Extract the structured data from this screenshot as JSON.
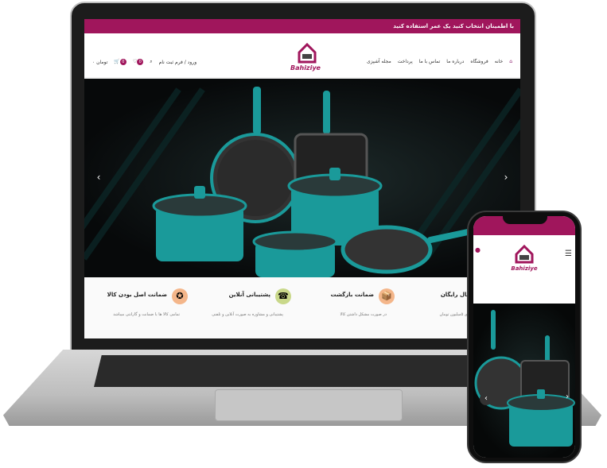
{
  "topbar": {
    "message": "با اطمینان انتخاب کنید یک عمر استفاده کنید"
  },
  "brand": {
    "logo_text": "Bahiziye"
  },
  "nav": [
    "خانه",
    "فروشگاه",
    "درباره ما",
    "تماس با ما",
    "پرداخت",
    "مجله آشپزی"
  ],
  "header_tools": {
    "login": "ورود / فرم ثبت نام",
    "cart_total": "۰ تومان",
    "cart_count": "0",
    "wishlist_count": "0"
  },
  "features": [
    {
      "title": "ارسال رایگان",
      "desc": "برای خرید بالای ۵میلیون تومان",
      "icon": "truck-icon",
      "color": "#8aa43a"
    },
    {
      "title": "ضمانت بازگشت",
      "desc": "در صورت مشکل داشتن کالا",
      "icon": "return-box-icon",
      "color": "#e87a2a"
    },
    {
      "title": "پشتیبانی آنلاین",
      "desc": "پشتیبانی و مشاوره به صورت آنلاین و تلفنی",
      "icon": "support-icon",
      "color": "#8aa43a"
    },
    {
      "title": "ضمانت اصل بودن کالا",
      "desc": "تمامی کالا ها با ضمانت و گارانتی میباشد",
      "icon": "medal-icon",
      "color": "#e87a2a"
    }
  ],
  "colors": {
    "brand": "#a0165c",
    "teal": "#1a9a9a",
    "dark": "#0a0c0c"
  }
}
